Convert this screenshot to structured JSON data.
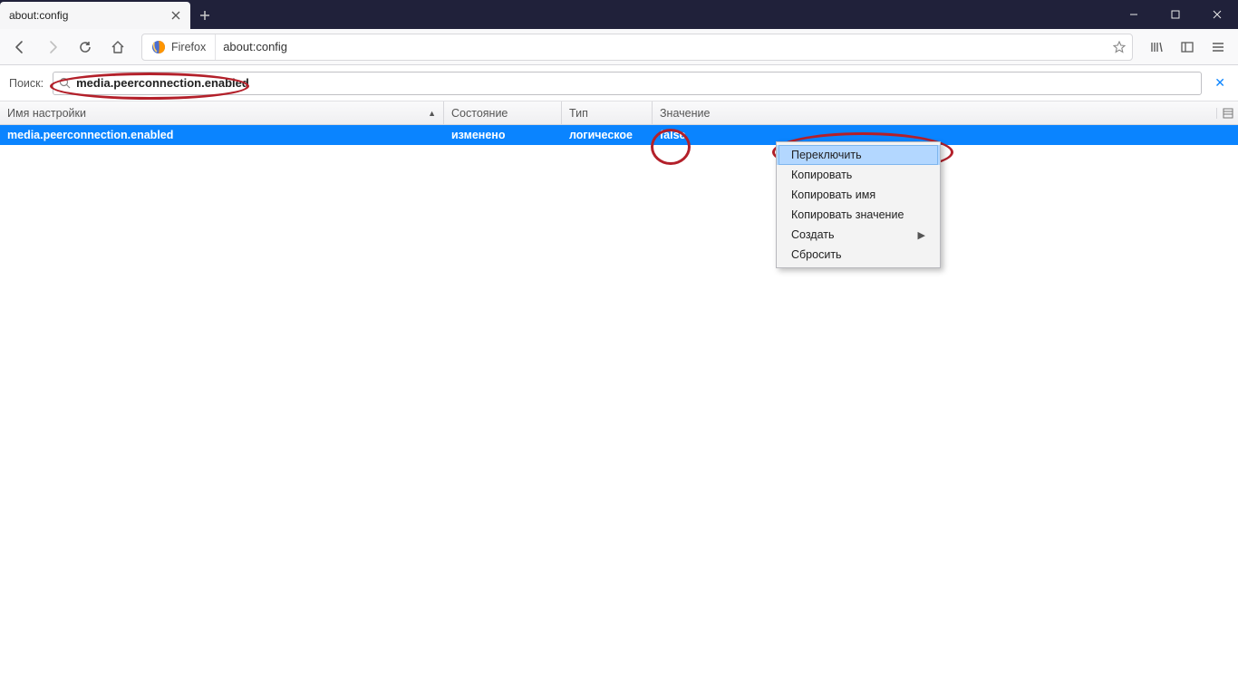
{
  "window": {
    "tab_title": "about:config",
    "identity_label": "Firefox",
    "url": "about:config"
  },
  "config": {
    "search_label": "Поиск:",
    "search_value": "media.peerconnection.enabled",
    "columns": {
      "name": "Имя настройки",
      "state": "Состояние",
      "type": "Тип",
      "value": "Значение"
    },
    "row": {
      "name": "media.peerconnection.enabled",
      "state": "изменено",
      "type": "логическое",
      "value": "false"
    }
  },
  "context_menu": {
    "items": [
      "Переключить",
      "Копировать",
      "Копировать имя",
      "Копировать значение",
      "Создать",
      "Сбросить"
    ]
  }
}
